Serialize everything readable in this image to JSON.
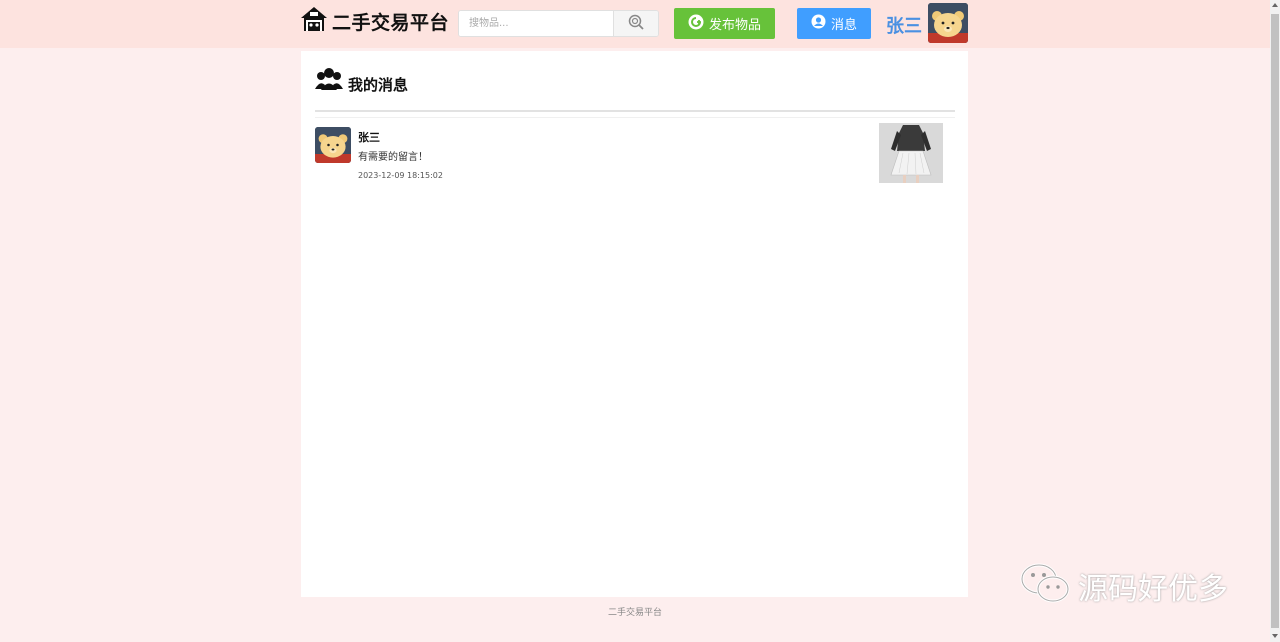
{
  "header": {
    "logo_title": "二手交易平台",
    "logo_icon": "house-icon",
    "search": {
      "placeholder": "搜物品...",
      "value": "",
      "button_icon": "search-icon"
    },
    "publish_button": {
      "label": "发布物品",
      "icon": "plus-circle-icon",
      "color": "#67c23a"
    },
    "message_button": {
      "label": "消息",
      "icon": "user-bubble-icon",
      "color": "#409eff"
    },
    "user": {
      "name": "张三",
      "avatar": "bear-avatar"
    }
  },
  "main": {
    "title": "我的消息",
    "title_icon": "users-icon",
    "messages": [
      {
        "sender": "张三",
        "content": "有需要的留言！",
        "time": "2023-12-09 18:15:02",
        "avatar": "bear-avatar",
        "item_image": "dress-image"
      }
    ]
  },
  "footer": {
    "text": "二手交易平台"
  },
  "watermark": {
    "text": "源码好优多",
    "icon": "wechat-icon"
  },
  "colors": {
    "background": "#fdeeee",
    "header_bg": "#fde3df",
    "accent_blue": "#4a90e2"
  }
}
